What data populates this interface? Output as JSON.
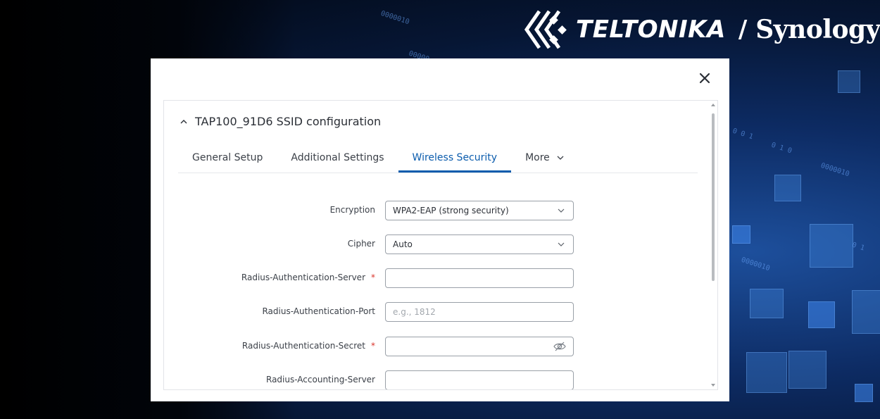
{
  "brand": {
    "logo_icon": "teltonika-chevron-logo",
    "teltonika": "TELTONIKA",
    "slash": "/",
    "synology": "Synology",
    "registered": "®"
  },
  "modal": {
    "close_icon": "close-icon",
    "panel_title": "TAP100_91D6 SSID configuration",
    "tabs": [
      {
        "label": "General Setup",
        "active": false
      },
      {
        "label": "Additional Settings",
        "active": false
      },
      {
        "label": "Wireless Security",
        "active": true
      },
      {
        "label": "More",
        "active": false
      }
    ],
    "form": {
      "encryption": {
        "label": "Encryption",
        "value": "WPA2-EAP (strong security)"
      },
      "cipher": {
        "label": "Cipher",
        "value": "Auto"
      },
      "radius_auth_server": {
        "label": "Radius-Authentication-Server",
        "required": "*",
        "value": ""
      },
      "radius_auth_port": {
        "label": "Radius-Authentication-Port",
        "placeholder": "e.g., 1812",
        "value": ""
      },
      "radius_auth_secret": {
        "label": "Radius-Authentication-Secret",
        "required": "*",
        "value": ""
      },
      "radius_acct_server": {
        "label": "Radius-Accounting-Server",
        "value": ""
      }
    }
  },
  "colors": {
    "accent": "#0b5cad",
    "required": "#d9342b"
  }
}
